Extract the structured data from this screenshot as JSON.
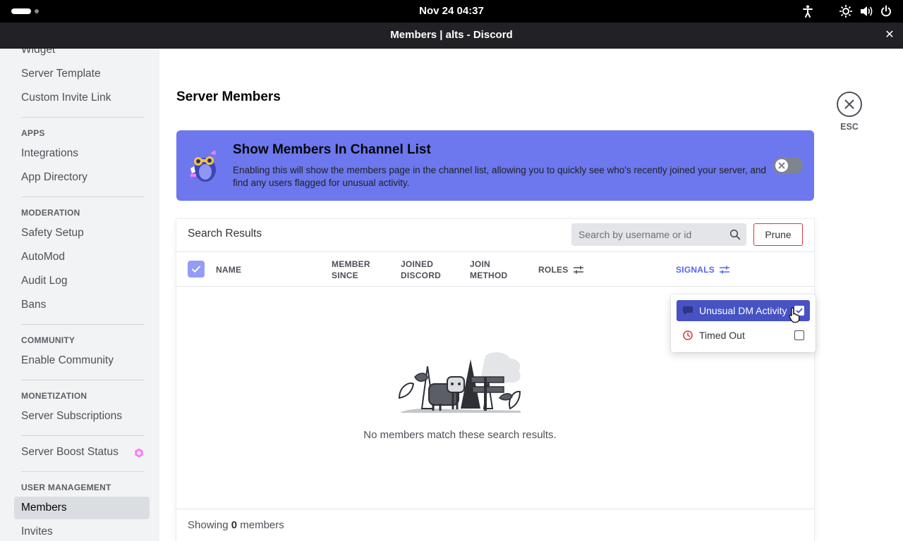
{
  "system_bar": {
    "clock": "Nov 24  04:37"
  },
  "window": {
    "title": "Members | alts - Discord",
    "close_glyph": "✕"
  },
  "sidebar": {
    "top_items": [
      "Widget",
      "Server Template",
      "Custom Invite Link"
    ],
    "apps_header": "APPS",
    "apps_items": [
      "Integrations",
      "App Directory"
    ],
    "moderation_header": "MODERATION",
    "moderation_items": [
      "Safety Setup",
      "AutoMod",
      "Audit Log",
      "Bans"
    ],
    "community_header": "COMMUNITY",
    "community_items": [
      "Enable Community"
    ],
    "monetization_header": "MONETIZATION",
    "monetization_items": [
      "Server Subscriptions"
    ],
    "boost_item": "Server Boost Status",
    "user_mgmt_header": "USER MANAGEMENT",
    "user_mgmt_items": [
      "Members",
      "Invites"
    ],
    "active_item": "Members"
  },
  "main": {
    "title": "Server Members",
    "esc_label": "ESC",
    "banner": {
      "title": "Show Members In Channel List",
      "description": "Enabling this will show the members page in the channel list, allowing you to quickly see who's recently joined your server, and find any users flagged for unusual activity.",
      "toggle_on": false,
      "color": "#6d78ee"
    },
    "results": {
      "title": "Search Results",
      "search_placeholder": "Search by username or id",
      "prune_label": "Prune",
      "columns": {
        "name": "NAME",
        "member_since_1": "MEMBER",
        "member_since_2": "SINCE",
        "joined_1": "JOINED",
        "joined_2": "DISCORD",
        "join_method_1": "JOIN",
        "join_method_2": "METHOD",
        "roles": "ROLES",
        "signals": "SIGNALS"
      },
      "empty_text": "No members match these search results.",
      "footer_prefix": "Showing",
      "footer_count": "0",
      "footer_suffix": "members"
    }
  },
  "signals_dropdown": {
    "items": [
      {
        "label": "Unusual DM Activity",
        "icon": "chat-bubble-icon",
        "checked": true
      },
      {
        "label": "Timed Out",
        "icon": "clock-icon",
        "checked": false
      }
    ]
  },
  "colors": {
    "accent": "#5865f2",
    "danger": "#da373c",
    "selected": "#4752c4"
  }
}
